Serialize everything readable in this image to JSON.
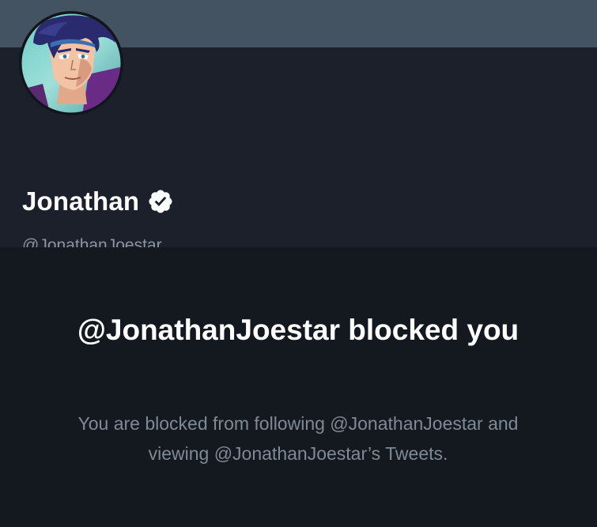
{
  "profile": {
    "display_name": "Jonathan",
    "handle": "@JonathanJoestar",
    "verified": true,
    "avatar_icon": "anime-portrait-avatar",
    "badge_icon": "verified-badge-icon"
  },
  "blocked": {
    "title": "@JonathanJoestar blocked you",
    "description": "You are blocked from following @JonathanJoestar and viewing @JonathanJoestar’s Tweets."
  },
  "colors": {
    "banner": "#445362",
    "panel": "#1b202a",
    "background": "#141920",
    "text_primary": "#ffffff",
    "text_secondary": "#8a96a3"
  }
}
